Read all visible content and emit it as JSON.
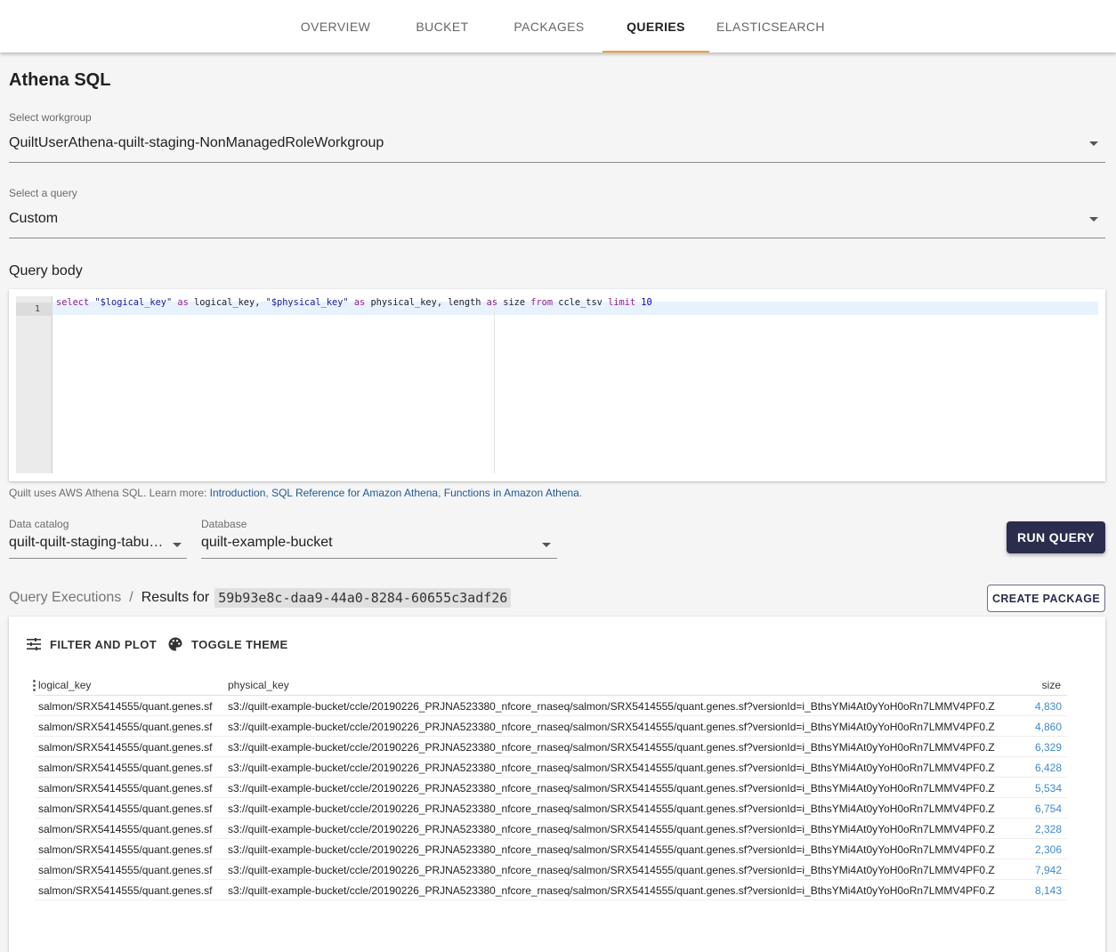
{
  "nav": {
    "tabs": [
      {
        "label": "OVERVIEW",
        "active": false
      },
      {
        "label": "BUCKET",
        "active": false
      },
      {
        "label": "PACKAGES",
        "active": false
      },
      {
        "label": "QUERIES",
        "active": true
      },
      {
        "label": "ELASTICSEARCH",
        "active": false
      }
    ],
    "accent_color": "#f0a030"
  },
  "page": {
    "title": "Athena SQL"
  },
  "workgroup": {
    "label": "Select workgroup",
    "value": "QuiltUserAthena-quilt-staging-NonManagedRoleWorkgroup"
  },
  "query_select": {
    "label": "Select a query",
    "value": "Custom"
  },
  "editor": {
    "label": "Query body",
    "line_number": "1",
    "tokens": {
      "t1": "select",
      "t2": "\"$logical_key\"",
      "t3": "as",
      "t4": "logical_key,",
      "t5": "\"$physical_key\"",
      "t6": "as",
      "t7": "physical_key, length",
      "t8": "as",
      "t9": "size",
      "t10": "from",
      "t11": "ccle_tsv",
      "t12": "limit",
      "t13": "10"
    }
  },
  "help": {
    "prefix": "Quilt uses AWS Athena SQL. Learn more: ",
    "links": [
      "Introduction",
      "SQL Reference for Amazon Athena",
      "Functions in Amazon Athena"
    ],
    "sep": ", ",
    "suffix": "."
  },
  "catalog": {
    "label": "Data catalog",
    "value": "quilt-quilt-staging-tabular-data"
  },
  "database": {
    "label": "Database",
    "value": "quilt-example-bucket"
  },
  "run_button": {
    "label": "RUN QUERY",
    "color": "#2a2d4d"
  },
  "breadcrumb": {
    "root": "Query Executions",
    "sep": "/",
    "current": "Results for",
    "execution_id": "59b93e8c-daa9-44a0-8284-60655c3adf26"
  },
  "create_package": {
    "label": "CREATE PACKAGE"
  },
  "results": {
    "toolbar": {
      "filter_plot": "FILTER AND PLOT",
      "toggle_theme": "TOGGLE THEME"
    },
    "columns": [
      "logical_key",
      "physical_key",
      "size"
    ],
    "rows": [
      [
        "salmon/SRX5414555/quant.genes.sf",
        "s3://quilt-example-bucket/ccle/20190226_PRJNA523380_nfcore_rnaseq/salmon/SRX5414555/quant.genes.sf?versionId=i_BthsYMi4At0yYoH0oRn7LMMV4PF0.Z",
        "4,830"
      ],
      [
        "salmon/SRX5414555/quant.genes.sf",
        "s3://quilt-example-bucket/ccle/20190226_PRJNA523380_nfcore_rnaseq/salmon/SRX5414555/quant.genes.sf?versionId=i_BthsYMi4At0yYoH0oRn7LMMV4PF0.Z",
        "4,860"
      ],
      [
        "salmon/SRX5414555/quant.genes.sf",
        "s3://quilt-example-bucket/ccle/20190226_PRJNA523380_nfcore_rnaseq/salmon/SRX5414555/quant.genes.sf?versionId=i_BthsYMi4At0yYoH0oRn7LMMV4PF0.Z",
        "6,329"
      ],
      [
        "salmon/SRX5414555/quant.genes.sf",
        "s3://quilt-example-bucket/ccle/20190226_PRJNA523380_nfcore_rnaseq/salmon/SRX5414555/quant.genes.sf?versionId=i_BthsYMi4At0yYoH0oRn7LMMV4PF0.Z",
        "6,428"
      ],
      [
        "salmon/SRX5414555/quant.genes.sf",
        "s3://quilt-example-bucket/ccle/20190226_PRJNA523380_nfcore_rnaseq/salmon/SRX5414555/quant.genes.sf?versionId=i_BthsYMi4At0yYoH0oRn7LMMV4PF0.Z",
        "5,534"
      ],
      [
        "salmon/SRX5414555/quant.genes.sf",
        "s3://quilt-example-bucket/ccle/20190226_PRJNA523380_nfcore_rnaseq/salmon/SRX5414555/quant.genes.sf?versionId=i_BthsYMi4At0yYoH0oRn7LMMV4PF0.Z",
        "6,754"
      ],
      [
        "salmon/SRX5414555/quant.genes.sf",
        "s3://quilt-example-bucket/ccle/20190226_PRJNA523380_nfcore_rnaseq/salmon/SRX5414555/quant.genes.sf?versionId=i_BthsYMi4At0yYoH0oRn7LMMV4PF0.Z",
        "2,328"
      ],
      [
        "salmon/SRX5414555/quant.genes.sf",
        "s3://quilt-example-bucket/ccle/20190226_PRJNA523380_nfcore_rnaseq/salmon/SRX5414555/quant.genes.sf?versionId=i_BthsYMi4At0yYoH0oRn7LMMV4PF0.Z",
        "2,306"
      ],
      [
        "salmon/SRX5414555/quant.genes.sf",
        "s3://quilt-example-bucket/ccle/20190226_PRJNA523380_nfcore_rnaseq/salmon/SRX5414555/quant.genes.sf?versionId=i_BthsYMi4At0yYoH0oRn7LMMV4PF0.Z",
        "7,942"
      ],
      [
        "salmon/SRX5414555/quant.genes.sf",
        "s3://quilt-example-bucket/ccle/20190226_PRJNA523380_nfcore_rnaseq/salmon/SRX5414555/quant.genes.sf?versionId=i_BthsYMi4At0yYoH0oRn7LMMV4PF0.Z",
        "8,143"
      ]
    ]
  }
}
